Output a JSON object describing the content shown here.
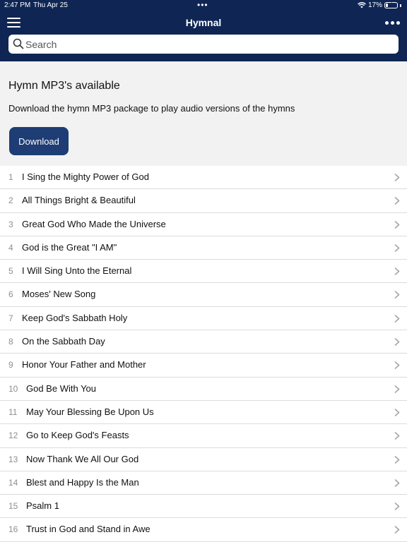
{
  "status_bar": {
    "time": "2:47 PM",
    "date": "Thu Apr 25",
    "center_indicator": "•••",
    "battery_percent": "17%",
    "battery_level": 0.17,
    "icons": [
      "wifi-icon",
      "battery-charging-icon"
    ]
  },
  "nav": {
    "title": "Hymnal",
    "menu_icon": "hamburger-menu-icon",
    "more_icon": "more-ellipsis-icon"
  },
  "search": {
    "placeholder": "Search",
    "value": "",
    "icon": "search-icon"
  },
  "promo": {
    "title": "Hymn MP3's available",
    "text": "Download the hymn MP3 package to play audio versions of the hymns",
    "button_label": "Download"
  },
  "hymns": [
    {
      "number": "1",
      "title": "I Sing the Mighty Power of God"
    },
    {
      "number": "2",
      "title": "All Things Bright & Beautiful"
    },
    {
      "number": "3",
      "title": "Great God Who Made the Universe"
    },
    {
      "number": "4",
      "title": "God is the Great \"I AM\""
    },
    {
      "number": "5",
      "title": "I Will Sing Unto the Eternal"
    },
    {
      "number": "6",
      "title": "Moses' New Song"
    },
    {
      "number": "7",
      "title": "Keep God's Sabbath Holy"
    },
    {
      "number": "8",
      "title": "On the Sabbath Day"
    },
    {
      "number": "9",
      "title": "Honor Your Father and Mother"
    },
    {
      "number": "10",
      "title": "God Be With You"
    },
    {
      "number": "11",
      "title": "May Your Blessing Be Upon Us"
    },
    {
      "number": "12",
      "title": "Go to Keep God's Feasts"
    },
    {
      "number": "13",
      "title": "Now Thank We All Our God"
    },
    {
      "number": "14",
      "title": "Blest and Happy Is the Man"
    },
    {
      "number": "15",
      "title": "Psalm 1"
    },
    {
      "number": "16",
      "title": "Trust in God and Stand in Awe"
    }
  ],
  "colors": {
    "header_background": "#0f2655",
    "button_background": "#1d3d74",
    "promo_background": "#f2f2f2"
  }
}
